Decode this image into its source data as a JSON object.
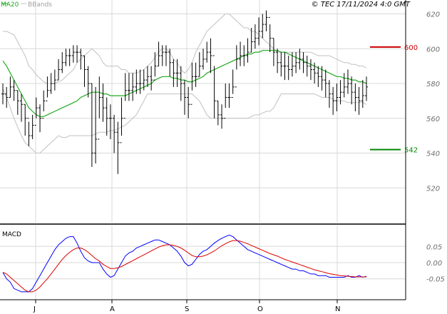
{
  "header": {
    "legend_ma20": "MA20",
    "legend_bbands": "BBands",
    "copyright": "© TEC 17/11/2024 4:0 GMT"
  },
  "colors": {
    "price": "#000000",
    "ma20": "#22aa22",
    "bbands": "#c0c0c0",
    "grid": "#d8d8d8",
    "resistance": "#cc0000",
    "support": "#008800",
    "macd": "#0000ff",
    "signal": "#dd0000",
    "axis_text": "#6e6e6e"
  },
  "chart_data": [
    {
      "type": "ohlc",
      "title": "",
      "ylim": [
        500,
        628
      ],
      "yticks": [
        520,
        540,
        560,
        580,
        600,
        620
      ],
      "ytick_labels": [
        "520",
        "540",
        "560",
        "580",
        "600",
        "620"
      ],
      "x_labels": [
        "J",
        "A",
        "S",
        "O",
        "N"
      ],
      "grid": true,
      "legend": "top-left",
      "levels": [
        {
          "label": "600",
          "value": 601,
          "kind": "resistance"
        },
        {
          "label": "542",
          "value": 542,
          "kind": "support"
        }
      ],
      "close": [
        574,
        572,
        578,
        576,
        570,
        568,
        560,
        550,
        556,
        566,
        560,
        570,
        576,
        580,
        582,
        588,
        592,
        596,
        596,
        598,
        598,
        596,
        588,
        580,
        540,
        548,
        572,
        566,
        560,
        560,
        552,
        546,
        560,
        576,
        576,
        578,
        580,
        580,
        582,
        584,
        582,
        590,
        596,
        598,
        598,
        592,
        586,
        586,
        580,
        572,
        568,
        584,
        584,
        590,
        594,
        598,
        596,
        570,
        562,
        560,
        572,
        572,
        578,
        594,
        596,
        596,
        598,
        604,
        606,
        610,
        614,
        618,
        606,
        598,
        592,
        590,
        590,
        588,
        590,
        592,
        594,
        592,
        590,
        588,
        586,
        584,
        582,
        580,
        574,
        570,
        572,
        575,
        578,
        580,
        575,
        572,
        570,
        573,
        578
      ],
      "high": [
        580,
        578,
        584,
        582,
        576,
        574,
        568,
        558,
        562,
        572,
        568,
        576,
        584,
        586,
        588,
        594,
        598,
        600,
        600,
        602,
        602,
        600,
        596,
        590,
        580,
        578,
        584,
        580,
        572,
        568,
        562,
        558,
        572,
        586,
        586,
        586,
        588,
        588,
        588,
        590,
        590,
        598,
        604,
        602,
        602,
        600,
        594,
        594,
        590,
        582,
        578,
        592,
        592,
        598,
        600,
        604,
        606,
        590,
        570,
        568,
        580,
        580,
        588,
        602,
        604,
        602,
        606,
        612,
        614,
        618,
        620,
        622,
        614,
        606,
        600,
        598,
        598,
        596,
        598,
        598,
        600,
        598,
        596,
        594,
        592,
        590,
        590,
        588,
        582,
        578,
        580,
        582,
        586,
        588,
        584,
        580,
        578,
        582,
        584
      ],
      "low": [
        568,
        566,
        572,
        570,
        562,
        558,
        550,
        544,
        548,
        560,
        552,
        564,
        572,
        574,
        576,
        582,
        586,
        590,
        590,
        592,
        592,
        588,
        578,
        572,
        532,
        534,
        560,
        558,
        550,
        548,
        540,
        528,
        550,
        570,
        570,
        570,
        574,
        574,
        576,
        578,
        576,
        584,
        590,
        590,
        590,
        584,
        578,
        578,
        570,
        562,
        560,
        576,
        578,
        584,
        588,
        592,
        586,
        560,
        556,
        554,
        566,
        566,
        574,
        588,
        590,
        590,
        592,
        598,
        600,
        602,
        606,
        610,
        598,
        590,
        586,
        584,
        582,
        582,
        584,
        586,
        588,
        586,
        584,
        582,
        580,
        578,
        576,
        572,
        566,
        562,
        564,
        568,
        572,
        574,
        568,
        564,
        562,
        566,
        570
      ],
      "ma20": [
        593,
        590,
        586,
        582,
        578,
        574,
        570,
        566,
        564,
        562,
        561,
        561,
        562,
        563,
        564,
        565,
        566,
        567,
        568,
        569,
        570,
        572,
        573,
        574,
        575,
        575,
        575,
        574,
        574,
        573,
        573,
        573,
        573,
        573,
        574,
        575,
        576,
        577,
        578,
        579,
        580,
        582,
        583,
        584,
        584,
        584,
        583,
        583,
        582,
        582,
        581,
        581,
        582,
        583,
        584,
        586,
        587,
        588,
        589,
        590,
        591,
        592,
        593,
        594,
        595,
        596,
        597,
        597,
        598,
        598,
        599,
        599,
        599,
        599,
        599,
        598,
        598,
        597,
        596,
        595,
        594,
        593,
        592,
        591,
        590,
        589,
        588,
        587,
        586,
        585,
        584,
        584,
        583,
        583,
        582,
        582,
        581,
        581,
        580
      ],
      "bb_upper": [
        610,
        610,
        609,
        608,
        604,
        600,
        596,
        590,
        588,
        585,
        583,
        581,
        580,
        580,
        580,
        581,
        582,
        584,
        586,
        588,
        592,
        594,
        596,
        598,
        600,
        598,
        596,
        592,
        590,
        590,
        590,
        590,
        588,
        588,
        586,
        586,
        586,
        587,
        588,
        590,
        592,
        595,
        598,
        600,
        600,
        598,
        594,
        592,
        588,
        586,
        588,
        592,
        598,
        602,
        606,
        610,
        612,
        614,
        616,
        618,
        620,
        620,
        618,
        616,
        614,
        612,
        612,
        610,
        610,
        608,
        606,
        604,
        602,
        600,
        598,
        598,
        598,
        598,
        598,
        598,
        598,
        598,
        598,
        598,
        597,
        596,
        596,
        596,
        596,
        595,
        594,
        593,
        592,
        592,
        591,
        591,
        590,
        590,
        589
      ],
      "bb_lower": [
        577,
        572,
        566,
        560,
        555,
        550,
        546,
        544,
        542,
        540,
        540,
        542,
        544,
        546,
        548,
        550,
        549,
        549,
        550,
        550,
        550,
        550,
        550,
        550,
        550,
        551,
        552,
        552,
        552,
        553,
        553,
        554,
        555,
        556,
        558,
        560,
        562,
        566,
        570,
        574,
        574,
        574,
        574,
        574,
        574,
        574,
        574,
        574,
        574,
        574,
        574,
        574,
        572,
        570,
        566,
        562,
        560,
        560,
        560,
        560,
        560,
        560,
        560,
        560,
        560,
        560,
        560,
        561,
        562,
        562,
        563,
        564,
        564,
        566,
        570,
        574,
        574,
        574,
        574,
        574,
        574,
        574,
        574,
        574,
        574,
        573,
        572,
        572,
        572,
        571,
        570,
        570,
        570,
        569,
        569,
        569,
        569,
        569,
        568
      ]
    },
    {
      "type": "line",
      "title": "MACD",
      "ylim": [
        -0.11,
        0.11
      ],
      "yticks": [
        0.05,
        0,
        -0.05
      ],
      "ytick_labels": [
        "0.05",
        "0.00",
        "-0.05"
      ],
      "series": [
        {
          "key": "macd",
          "values": [
            -0.03,
            -0.05,
            -0.06,
            -0.08,
            -0.085,
            -0.09,
            -0.09,
            -0.09,
            -0.08,
            -0.06,
            -0.04,
            -0.02,
            0.0,
            0.02,
            0.04,
            0.055,
            0.065,
            0.075,
            0.08,
            0.08,
            0.06,
            0.035,
            0.015,
            0.005,
            0.0,
            0.0,
            0.0,
            -0.02,
            -0.035,
            -0.045,
            -0.04,
            -0.02,
            0.0,
            0.02,
            0.03,
            0.035,
            0.045,
            0.05,
            0.055,
            0.06,
            0.065,
            0.07,
            0.07,
            0.065,
            0.06,
            0.055,
            0.045,
            0.035,
            0.02,
            0.0,
            -0.01,
            -0.005,
            0.01,
            0.025,
            0.035,
            0.04,
            0.05,
            0.06,
            0.068,
            0.075,
            0.08,
            0.085,
            0.08,
            0.07,
            0.06,
            0.05,
            0.04,
            0.035,
            0.03,
            0.025,
            0.02,
            0.015,
            0.01,
            0.005,
            0.0,
            -0.005,
            -0.01,
            -0.015,
            -0.02,
            -0.02,
            -0.025,
            -0.025,
            -0.03,
            -0.035,
            -0.035,
            -0.04,
            -0.04,
            -0.04,
            -0.045,
            -0.045,
            -0.045,
            -0.045,
            -0.045,
            -0.04,
            -0.045,
            -0.045,
            -0.04,
            -0.045,
            -0.042
          ]
        },
        {
          "key": "signal",
          "values": [
            -0.03,
            -0.035,
            -0.045,
            -0.055,
            -0.065,
            -0.075,
            -0.085,
            -0.09,
            -0.09,
            -0.085,
            -0.075,
            -0.062,
            -0.05,
            -0.035,
            -0.02,
            -0.005,
            0.01,
            0.022,
            0.032,
            0.04,
            0.045,
            0.045,
            0.04,
            0.032,
            0.022,
            0.012,
            0.005,
            -0.005,
            -0.012,
            -0.018,
            -0.018,
            -0.016,
            -0.012,
            -0.006,
            0.0,
            0.006,
            0.012,
            0.018,
            0.024,
            0.03,
            0.036,
            0.042,
            0.048,
            0.052,
            0.055,
            0.055,
            0.053,
            0.05,
            0.045,
            0.038,
            0.03,
            0.022,
            0.018,
            0.018,
            0.02,
            0.024,
            0.03,
            0.036,
            0.044,
            0.052,
            0.058,
            0.064,
            0.068,
            0.068,
            0.066,
            0.062,
            0.058,
            0.053,
            0.048,
            0.043,
            0.038,
            0.033,
            0.028,
            0.024,
            0.02,
            0.015,
            0.01,
            0.006,
            0.002,
            -0.002,
            -0.006,
            -0.01,
            -0.014,
            -0.018,
            -0.022,
            -0.025,
            -0.028,
            -0.031,
            -0.034,
            -0.036,
            -0.038,
            -0.04,
            -0.041,
            -0.042,
            -0.043,
            -0.044,
            -0.044,
            -0.044,
            -0.044
          ]
        }
      ]
    }
  ]
}
